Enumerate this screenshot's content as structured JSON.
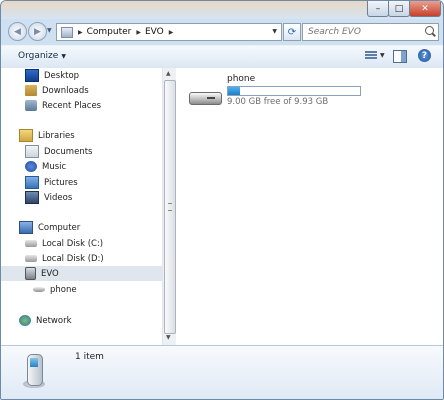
{
  "window": {
    "caption_minimize": "–",
    "caption_maximize": "□",
    "caption_close": "✕"
  },
  "address_bar": {
    "back_glyph": "◀",
    "forward_glyph": "▶",
    "path": [
      "Computer",
      "EVO"
    ],
    "separator_glyph": "▶",
    "dropdown_glyph": "▼",
    "refresh_glyph": "⟳",
    "search_placeholder": "Search EVO"
  },
  "toolbar": {
    "organize_label": "Organize",
    "dropdown_glyph": "▼",
    "help_glyph": "?"
  },
  "navigation_pane": {
    "items": [
      {
        "label": "Desktop",
        "icon": "desktop-icon"
      },
      {
        "label": "Downloads",
        "icon": "downloads-icon"
      },
      {
        "label": "Recent Places",
        "icon": "recent-places-icon"
      },
      {
        "label": "Libraries",
        "icon": "libraries-icon"
      },
      {
        "label": "Documents",
        "icon": "documents-icon"
      },
      {
        "label": "Music",
        "icon": "music-icon"
      },
      {
        "label": "Pictures",
        "icon": "pictures-icon"
      },
      {
        "label": "Videos",
        "icon": "videos-icon"
      },
      {
        "label": "Computer",
        "icon": "computer-icon"
      },
      {
        "label": "Local Disk (C:)",
        "icon": "local-disk-icon"
      },
      {
        "label": "Local Disk (D:)",
        "icon": "local-disk-icon"
      },
      {
        "label": "EVO",
        "icon": "removable-device-icon",
        "selected": true
      },
      {
        "label": "phone",
        "icon": "drive-icon"
      },
      {
        "label": "Network",
        "icon": "network-icon"
      }
    ]
  },
  "content": {
    "drive": {
      "name": "phone",
      "free_text": "9.00 GB free of 9.93 GB",
      "used_fraction": 0.094,
      "bar_color": "#1d7fc7",
      "icon": "removable-drive-icon"
    }
  },
  "details_pane": {
    "item_count": "1 item",
    "icon": "mobile-device-icon"
  }
}
